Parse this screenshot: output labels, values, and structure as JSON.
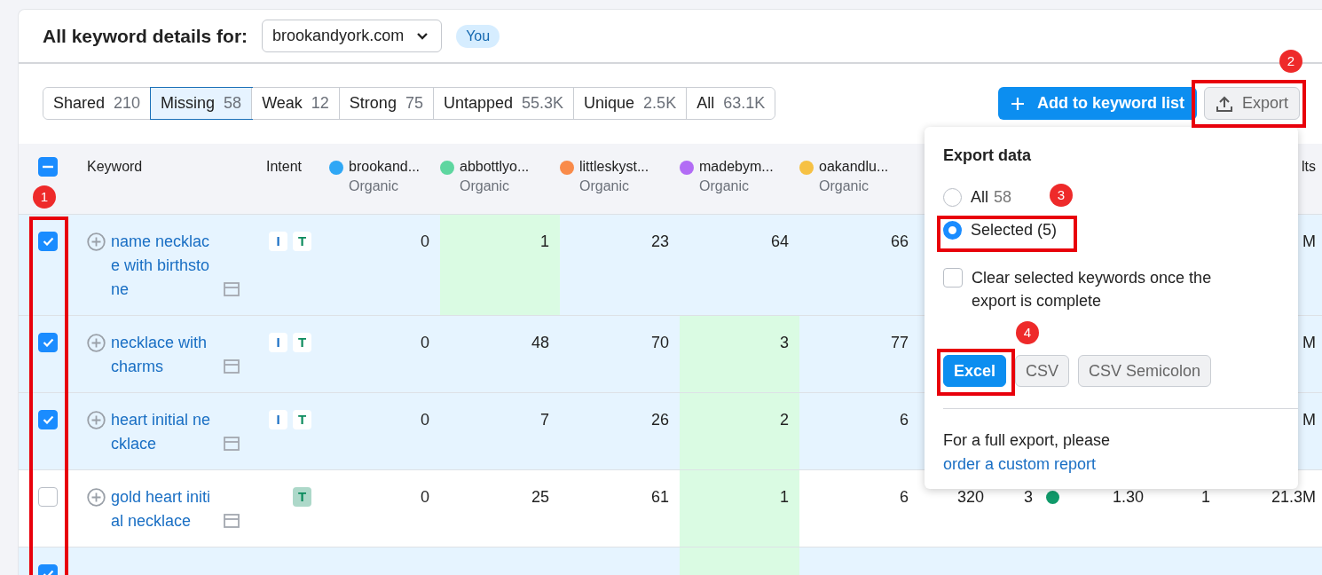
{
  "header": {
    "title": "All keyword details for:",
    "domain": "brookandyork.com",
    "badge": "You"
  },
  "tabs": [
    {
      "label": "Shared",
      "count": "210",
      "selected": false
    },
    {
      "label": "Missing",
      "count": "58",
      "selected": true
    },
    {
      "label": "Weak",
      "count": "12",
      "selected": false
    },
    {
      "label": "Strong",
      "count": "75",
      "selected": false
    },
    {
      "label": "Untapped",
      "count": "55.3K",
      "selected": false
    },
    {
      "label": "Unique",
      "count": "2.5K",
      "selected": false
    },
    {
      "label": "All",
      "count": "63.1K",
      "selected": false
    }
  ],
  "actions": {
    "add_button": "Add to keyword list",
    "export_button": "Export"
  },
  "table": {
    "select_all": {
      "indeterminate": true
    },
    "columns": {
      "keyword": "Keyword",
      "intent": "Intent",
      "column_13": "lts",
      "domains": [
        {
          "name": "brookand...",
          "sub": "Organic",
          "color": "#2fa7f5"
        },
        {
          "name": "abbottlyo...",
          "sub": "Organic",
          "color": "#5ed6a0"
        },
        {
          "name": "littleskyst...",
          "sub": "Organic",
          "color": "#f98b4a"
        },
        {
          "name": "madebym...",
          "sub": "Organic",
          "color": "#b26cf5"
        },
        {
          "name": "oakandlu...",
          "sub": "Organic",
          "color": "#f6c144"
        }
      ]
    },
    "rows": [
      {
        "checked": true,
        "keyword": "name necklace with birthstone",
        "intents": [
          {
            "label": "I",
            "color": "#1a6fc4"
          },
          {
            "label": "T",
            "color": "#0a8a5c"
          }
        ],
        "values": [
          {
            "value": "0",
            "highlighted": false
          },
          {
            "value": "1",
            "highlighted": true
          },
          {
            "value": "23",
            "highlighted": false
          },
          {
            "value": "64",
            "highlighted": false
          },
          {
            "value": "66",
            "highlighted": false
          }
        ],
        "extra": {
          "column_13": "M"
        }
      },
      {
        "checked": true,
        "keyword": "necklace with charms",
        "intents": [
          {
            "label": "I",
            "color": "#1a6fc4"
          },
          {
            "label": "T",
            "color": "#0a8a5c"
          }
        ],
        "values": [
          {
            "value": "0",
            "highlighted": false
          },
          {
            "value": "48",
            "highlighted": false
          },
          {
            "value": "70",
            "highlighted": false
          },
          {
            "value": "3",
            "highlighted": true
          },
          {
            "value": "77",
            "highlighted": false
          }
        ],
        "extra": {
          "column_13": "M"
        }
      },
      {
        "checked": true,
        "keyword": "heart initial necklace",
        "intents": [
          {
            "label": "I",
            "color": "#1a6fc4"
          },
          {
            "label": "T",
            "color": "#0a8a5c"
          }
        ],
        "values": [
          {
            "value": "0",
            "highlighted": false
          },
          {
            "value": "7",
            "highlighted": false
          },
          {
            "value": "26",
            "highlighted": false
          },
          {
            "value": "2",
            "highlighted": true
          },
          {
            "value": "6",
            "highlighted": false
          }
        ],
        "extra": {
          "column_13": "M"
        }
      },
      {
        "checked": false,
        "keyword": "gold heart initial necklace",
        "intents": [
          {
            "label": "T",
            "color": "#0a8a5c"
          }
        ],
        "values": [
          {
            "value": "0",
            "highlighted": false
          },
          {
            "value": "25",
            "highlighted": false
          },
          {
            "value": "61",
            "highlighted": false
          },
          {
            "value": "1",
            "highlighted": true
          },
          {
            "value": "6",
            "highlighted": false
          }
        ],
        "extra": {
          "column_9": "320",
          "column_10": {
            "value": "3",
            "color": "#109a6a"
          },
          "column_11": "1.30",
          "column_12": "1",
          "column_13": "21.3M"
        }
      },
      {
        "kind": "cut",
        "checked": true,
        "values": [
          {
            "highlighted": false
          },
          {
            "highlighted": false
          },
          {
            "highlighted": false
          },
          {
            "highlighted": true
          },
          {
            "highlighted": false
          }
        ]
      }
    ]
  },
  "export_popover": {
    "title": "Export data",
    "options": [
      {
        "label": "All",
        "count": "58",
        "selected": false
      },
      {
        "label": "Selected (5)",
        "selected": true
      }
    ],
    "clear_option": {
      "label": "Clear selected keywords once the export is complete",
      "checked": false
    },
    "formats": [
      {
        "label": "Excel",
        "selected": true
      },
      {
        "label": "CSV",
        "selected": false
      },
      {
        "label": "CSV Semicolon",
        "selected": false
      }
    ],
    "footer_text": "For a full export, please",
    "footer_link": "order a custom report"
  },
  "annotations": [
    {
      "number": "1"
    },
    {
      "number": "2"
    },
    {
      "number": "3"
    },
    {
      "number": "4"
    }
  ]
}
